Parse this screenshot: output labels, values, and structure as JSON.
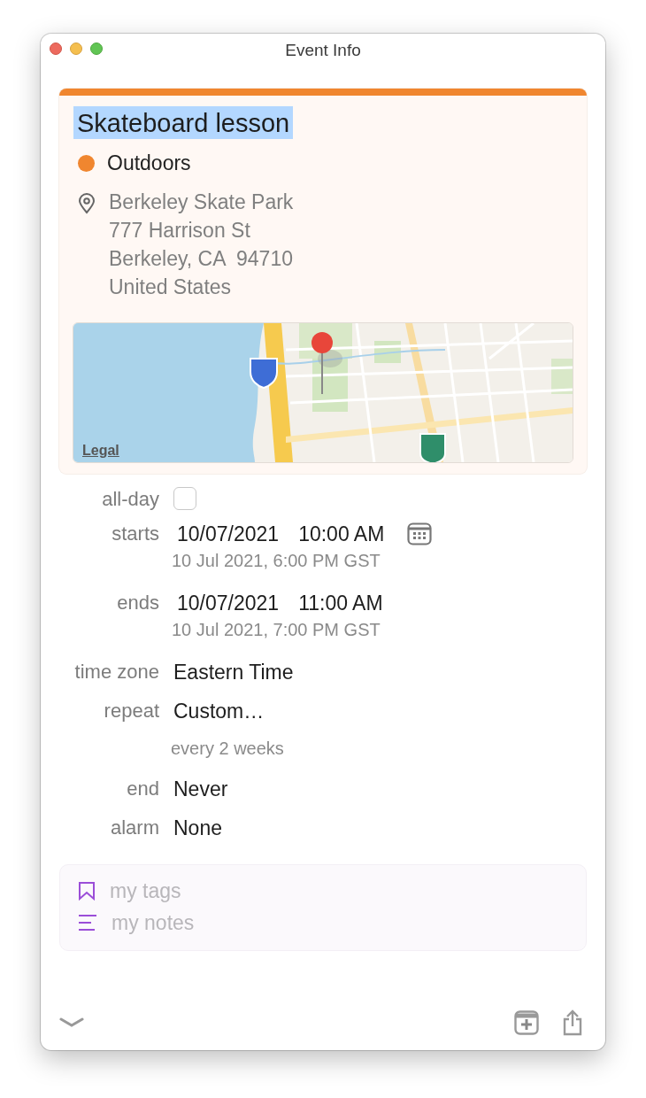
{
  "window": {
    "title": "Event Info"
  },
  "event": {
    "title": "Skateboard lesson",
    "title_selected": true,
    "calendar": {
      "name": "Outdoors",
      "color": "#f0862f"
    },
    "location": [
      "Berkeley Skate Park",
      "777 Harrison St",
      "Berkeley, CA  94710",
      "United States"
    ],
    "map": {
      "kind": "picture",
      "legal_link": "Legal"
    }
  },
  "fields": [
    {
      "kind": "checkbox",
      "label": "all-day",
      "checked": false
    },
    {
      "kind": "datetime",
      "label": "starts",
      "date": "10/07/2021",
      "time": "10:00 AM",
      "converted": "10 Jul 2021, 6:00 PM GST",
      "calendar_button": true
    },
    {
      "kind": "datetime",
      "label": "ends",
      "date": "10/07/2021",
      "time": "11:00 AM",
      "converted": "10 Jul 2021, 7:00 PM GST",
      "calendar_button": false
    },
    {
      "kind": "value",
      "label": "time zone",
      "value": "Eastern Time"
    },
    {
      "kind": "value",
      "label": "repeat",
      "value": "Custom…",
      "note": "every 2 weeks"
    },
    {
      "kind": "value",
      "label": "end",
      "value": "Never"
    },
    {
      "kind": "value",
      "label": "alarm",
      "value": "None"
    }
  ],
  "extras": {
    "tags_placeholder": "my tags",
    "notes_placeholder": "my notes"
  }
}
